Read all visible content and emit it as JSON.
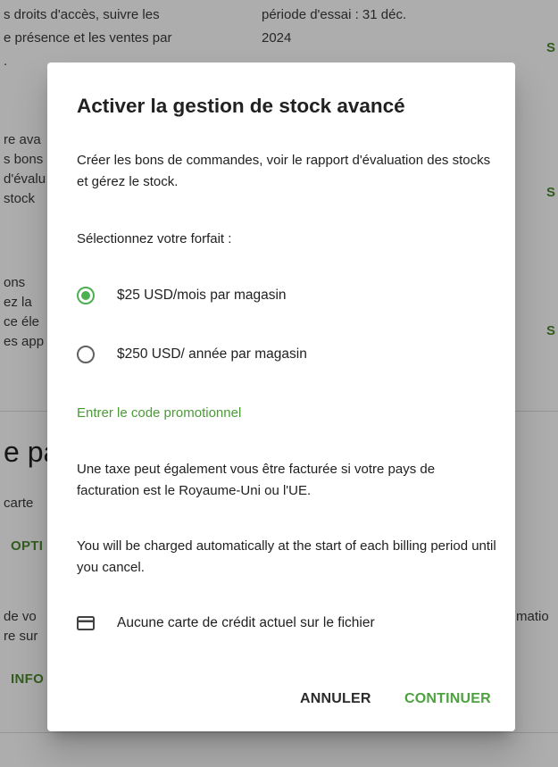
{
  "background": {
    "texts": [
      "s droits d'accès, suivre les",
      "e présence et les ventes par",
      ".",
      "période d'essai : 31 déc.",
      "2024",
      "re ava",
      "s bons",
      "d'évalu",
      "stock",
      "ons",
      "ez la",
      "ce éle",
      "es app",
      "carte",
      "de vo",
      "re sur",
      "matio"
    ],
    "green_texts": [
      "S",
      "S",
      "S",
      "OPTI",
      "INFO"
    ],
    "heading": "e pa"
  },
  "dialog": {
    "title": "Activer la gestion de stock avancé",
    "description": "Créer les bons de commandes, voir le rapport d'évaluation des stocks et gérez le stock.",
    "select_plan_label": "Sélectionnez votre forfait :",
    "plans": [
      {
        "label": "$25 USD/mois par magasin",
        "selected": true
      },
      {
        "label": "$250 USD/ année par magasin",
        "selected": false
      }
    ],
    "promo_link": "Entrer le code promotionnel",
    "tax_note": "Une taxe peut également vous être facturée si votre pays de facturation est le Royaume-Uni ou l'UE.",
    "billing_note": "You will be charged automatically at the start of each billing period until you cancel.",
    "card": {
      "icon": "credit-card-icon",
      "label": "Aucune carte de crédit actuel sur le fichier"
    },
    "buttons": {
      "cancel": "ANNULER",
      "continue": "CONTINUER"
    }
  },
  "colors": {
    "accent": "#4caf50",
    "link": "#4a9a36",
    "scrim": "rgba(0,0,0,0.32)"
  }
}
